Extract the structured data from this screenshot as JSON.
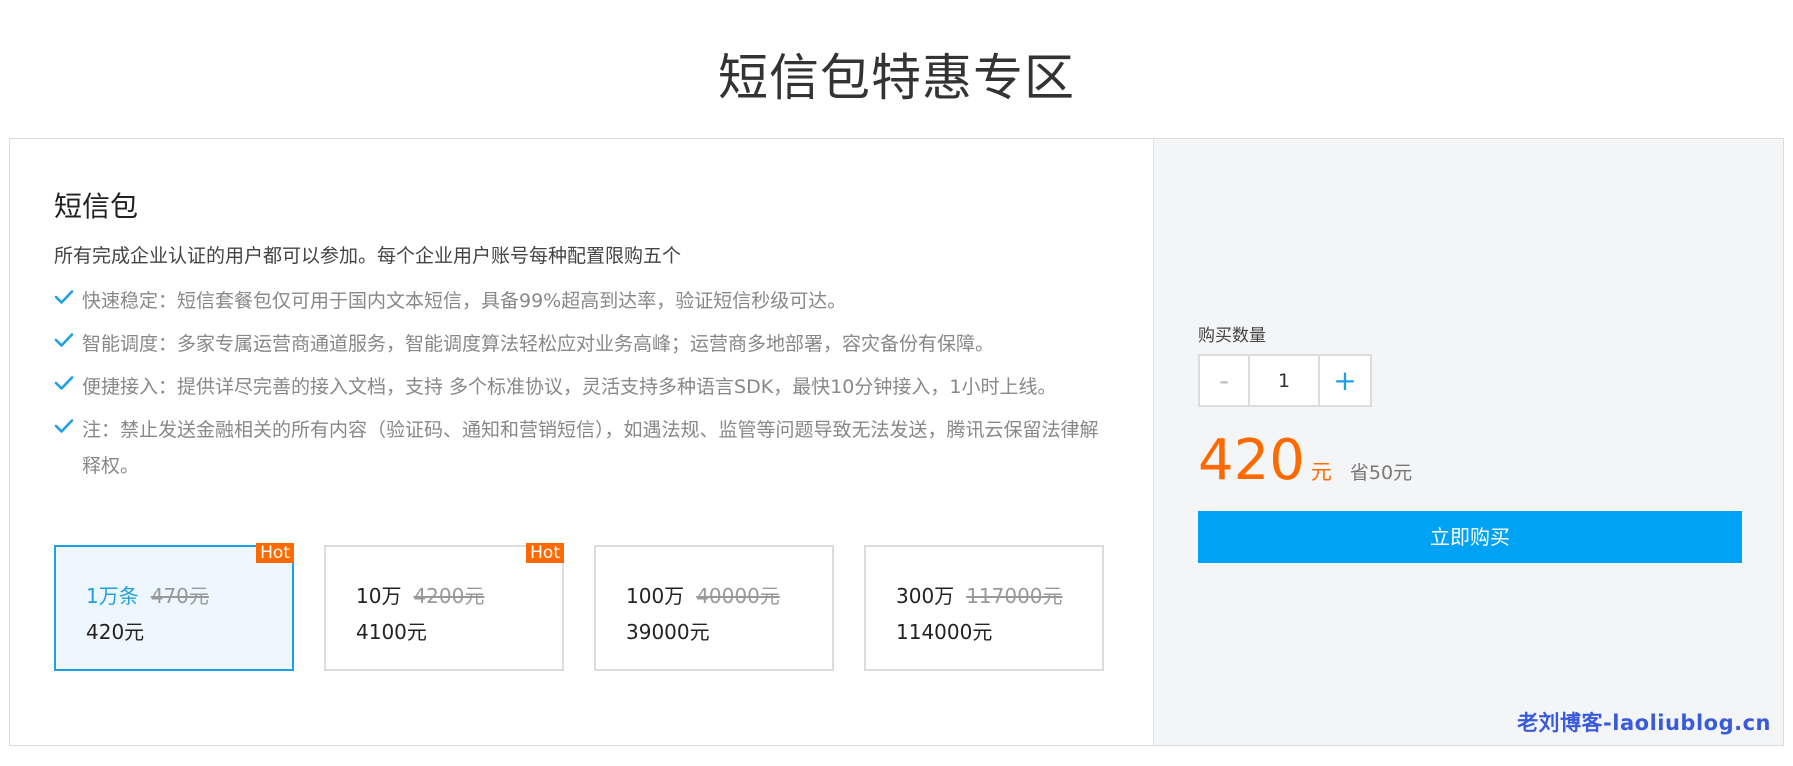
{
  "page": {
    "title": "短信包特惠专区"
  },
  "package": {
    "title": "短信包",
    "description": "所有完成企业认证的用户都可以参加。每个企业用户账号每种配置限购五个",
    "features": [
      {
        "text": "快速稳定：短信套餐包仅可用于国内文本短信，具备99%超高到达率，验证短信秒级可达。"
      },
      {
        "text": "智能调度：多家专属运营商通道服务，智能调度算法轻松应对业务高峰；运营商多地部署，容灾备份有保障。"
      },
      {
        "text": "便捷接入：提供详尽完善的接入文档，支持 多个标准协议，灵活支持多种语言SDK，最快10分钟接入，1小时上线。"
      },
      {
        "text": "注：禁止发送金融相关的所有内容（验证码、通知和营销短信），如遇法规、监管等问题导致无法发送，腾讯云保留法律解释权。"
      }
    ],
    "options": [
      {
        "qty": "1万条",
        "original": "470元",
        "price": "420元",
        "badge": "Hot",
        "selected": true
      },
      {
        "qty": "10万",
        "original": "4200元",
        "price": "4100元",
        "badge": "Hot",
        "selected": false
      },
      {
        "qty": "100万",
        "original": "40000元",
        "price": "39000元",
        "badge": "",
        "selected": false
      },
      {
        "qty": "300万",
        "original": "117000元",
        "price": "114000元",
        "badge": "",
        "selected": false
      }
    ]
  },
  "purchase": {
    "qty_label": "购买数量",
    "minus": "-",
    "plus": "+",
    "qty_value": "1",
    "price": "420",
    "price_unit": "元",
    "save_text": "省50元",
    "buy_label": "立即购买"
  },
  "watermark": "老刘博客-laoliublog.cn",
  "colors": {
    "accent": "#00a2f5",
    "price": "#ff6a00",
    "selected_border": "#1e9fe6"
  },
  "icons": {
    "feature_bullet": "check-icon"
  }
}
